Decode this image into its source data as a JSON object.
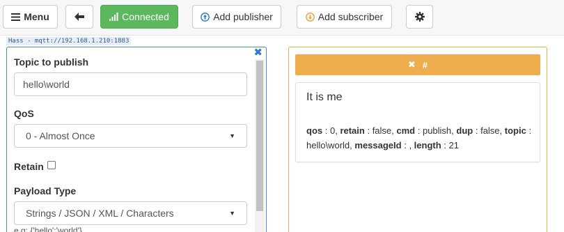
{
  "toolbar": {
    "menu_label": "Menu",
    "back_icon": "arrow-left-icon",
    "connected_label": "Connected",
    "add_publisher_label": "Add publisher",
    "add_subscriber_label": "Add subscriber",
    "settings_icon": "gear-icon",
    "connected_color": "#5cb85c"
  },
  "connection": {
    "label": "Hass - mqtt://192.168.1.210:1883"
  },
  "publisher": {
    "topic_label": "Topic to publish",
    "topic_value": "hello\\world",
    "qos_label": "QoS",
    "qos_value": "0 - Almost Once",
    "retain_label": "Retain",
    "retain_checked": false,
    "payload_type_label": "Payload Type",
    "payload_type_value": "Strings / JSON / XML / Characters",
    "hint": "e.g: {'hello':'world'}",
    "border_color": "#4d8fd4"
  },
  "subscriber": {
    "topic": "#",
    "header_color": "#f0ad4e",
    "message": {
      "payload": "It is me",
      "qos_key": "qos",
      "qos_val": "0",
      "retain_key": "retain",
      "retain_val": "false",
      "cmd_key": "cmd",
      "cmd_val": "publish",
      "dup_key": "dup",
      "dup_val": "false",
      "topic_key": "topic",
      "topic_val": "hello\\world",
      "messageId_key": "messageId",
      "messageId_val": "",
      "length_key": "length",
      "length_val": "21"
    }
  }
}
